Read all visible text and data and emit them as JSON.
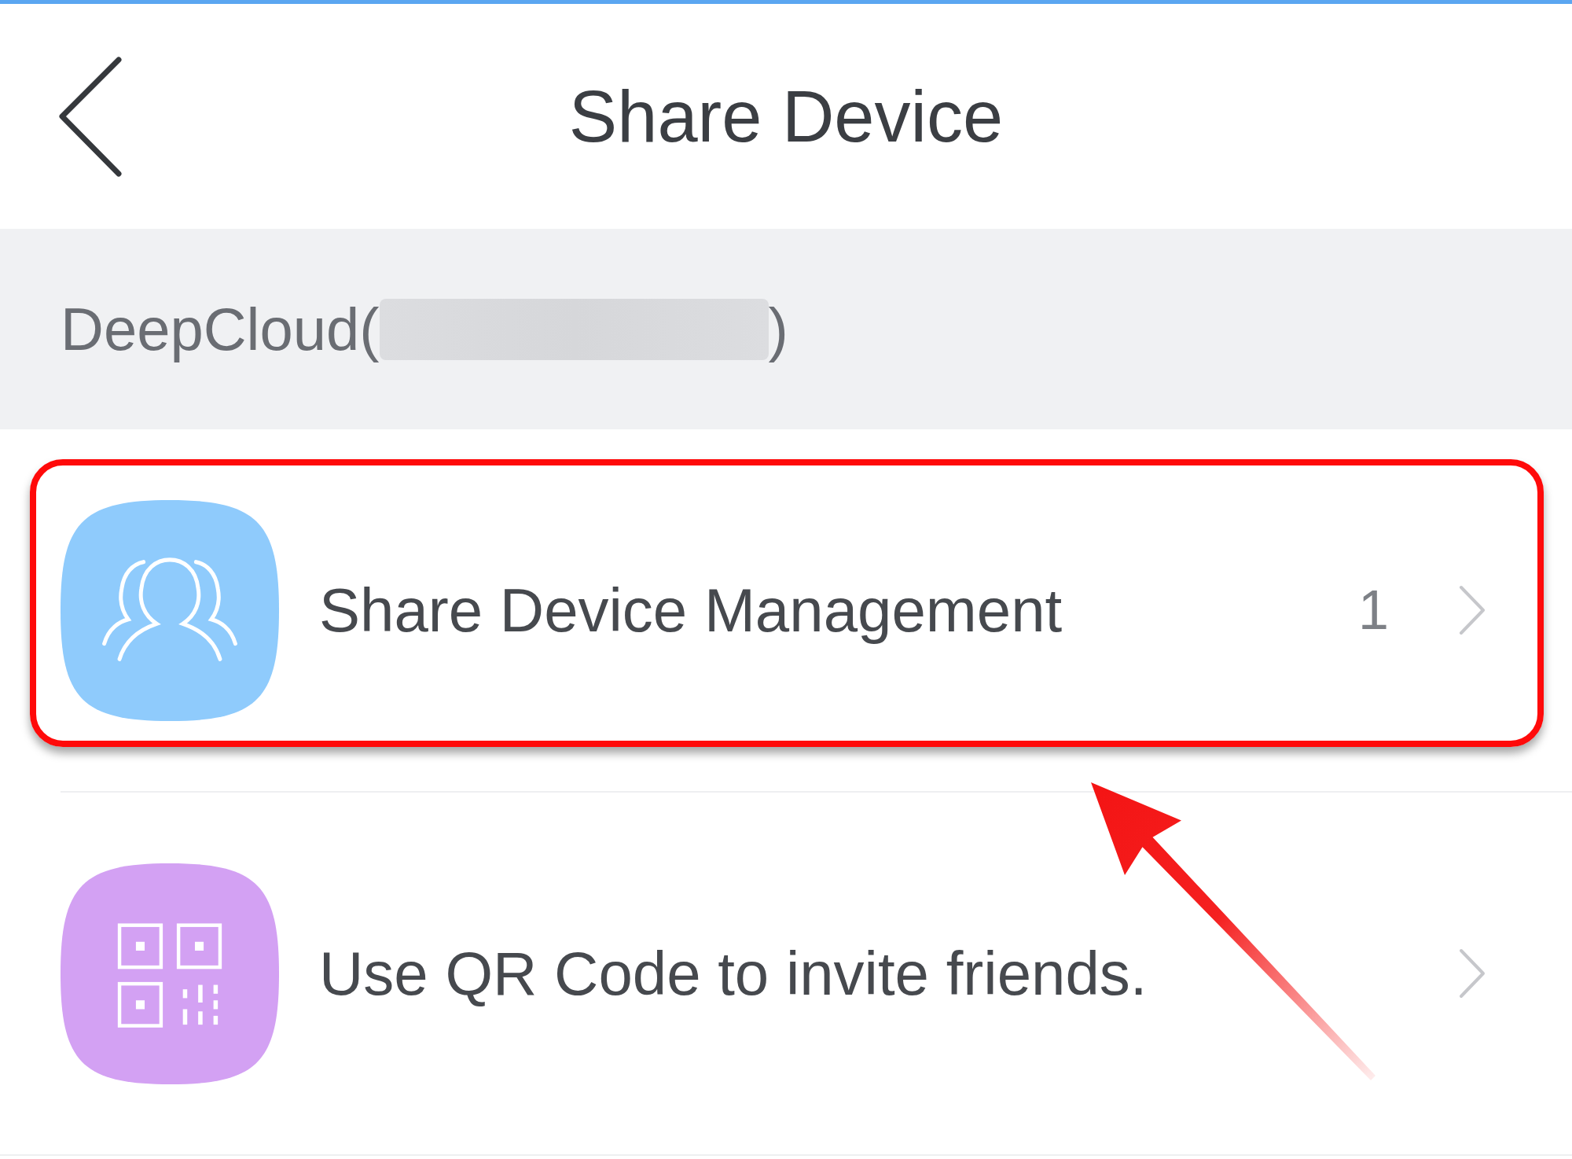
{
  "header": {
    "title": "Share Device"
  },
  "device": {
    "name_start": "DeepCloud(",
    "redacted": true,
    "name_end": ")"
  },
  "items": [
    {
      "kind": "users",
      "color": "#8fcbfc",
      "label": "Share Device Management",
      "count": "1",
      "highlighted": true
    },
    {
      "kind": "qr",
      "color": "#d3a1f3",
      "label": "Use QR Code to invite friends.",
      "highlighted": false
    }
  ]
}
